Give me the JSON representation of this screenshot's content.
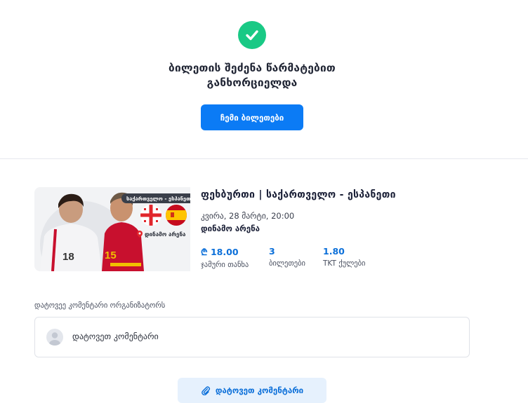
{
  "success": {
    "icon": "check-icon",
    "title_line1": "ბილეთის შეძენა წარმატებით",
    "title_line2": "განხორციელდა",
    "my_tickets_label": "ჩემი ბილეთები"
  },
  "event": {
    "image_tag": "საქართველო - ესპანეთი",
    "image_venue": "დინამო არენა",
    "title": "ფეხბურთი | საქართველო - ესპანეთი",
    "date": "კვირა, 28 მარტი, 20:00",
    "venue": "დინამო არენა",
    "stats": [
      {
        "value": "₾ 18.00",
        "label": "ჯამური თანხა"
      },
      {
        "value": "3",
        "label": "ბილეთები"
      },
      {
        "value": "1.80",
        "label": "TKT ქულები"
      }
    ]
  },
  "comment": {
    "label": "დატოვეე კომენტარი ორგანიზატორს",
    "placeholder": "დატოვეთ კომენტარი",
    "button_label": "დატოვეთ კომენტარი",
    "button_icon": "paperclip-icon"
  },
  "colors": {
    "primary": "#0b7bf5",
    "success": "#19c985",
    "accent_text": "#0b6fd9"
  }
}
